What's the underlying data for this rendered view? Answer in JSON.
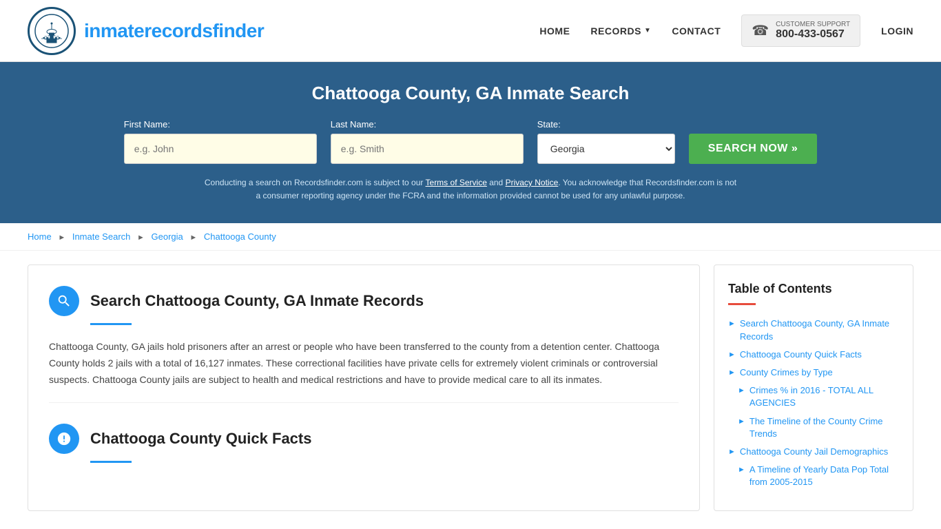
{
  "header": {
    "logo_text_regular": "inmaterecords",
    "logo_text_bold": "finder",
    "nav": {
      "home": "HOME",
      "records": "RECORDS",
      "contact": "CONTACT",
      "login": "LOGIN"
    },
    "support": {
      "label": "CUSTOMER SUPPORT",
      "phone": "800-433-0567"
    }
  },
  "search_banner": {
    "title": "Chattooga County, GA Inmate Search",
    "first_name_label": "First Name:",
    "first_name_placeholder": "e.g. John",
    "last_name_label": "Last Name:",
    "last_name_placeholder": "e.g. Smith",
    "state_label": "State:",
    "state_value": "Georgia",
    "search_button": "SEARCH NOW »",
    "disclaimer": "Conducting a search on Recordsfinder.com is subject to our Terms of Service and Privacy Notice. You acknowledge that Recordsfinder.com is not a consumer reporting agency under the FCRA and the information provided cannot be used for any unlawful purpose.",
    "terms_link": "Terms of Service",
    "privacy_link": "Privacy Notice"
  },
  "breadcrumb": {
    "home": "Home",
    "inmate_search": "Inmate Search",
    "state": "Georgia",
    "county": "Chattooga County"
  },
  "main_section": {
    "title": "Search Chattooga County, GA Inmate Records",
    "body": "Chattooga County, GA jails hold prisoners after an arrest or people who have been transferred to the county from a detention center. Chattooga County holds 2 jails with a total of 16,127 inmates. These correctional facilities have private cells for extremely violent criminals or controversial suspects. Chattooga County jails are subject to health and medical restrictions and have to provide medical care to all its inmates."
  },
  "quick_facts_section": {
    "title": "Chattooga County Quick Facts"
  },
  "toc": {
    "title": "Table of Contents",
    "items": [
      {
        "label": "Search Chattooga County, GA Inmate Records",
        "sub": false
      },
      {
        "label": "Chattooga County Quick Facts",
        "sub": false
      },
      {
        "label": "County Crimes by Type",
        "sub": false
      },
      {
        "label": "Crimes % in 2016 - TOTAL ALL AGENCIES",
        "sub": true
      },
      {
        "label": "The Timeline of the County Crime Trends",
        "sub": true
      },
      {
        "label": "Chattooga County Jail Demographics",
        "sub": false
      },
      {
        "label": "A Timeline of Yearly Data Pop Total from 2005-2015",
        "sub": true
      }
    ]
  }
}
